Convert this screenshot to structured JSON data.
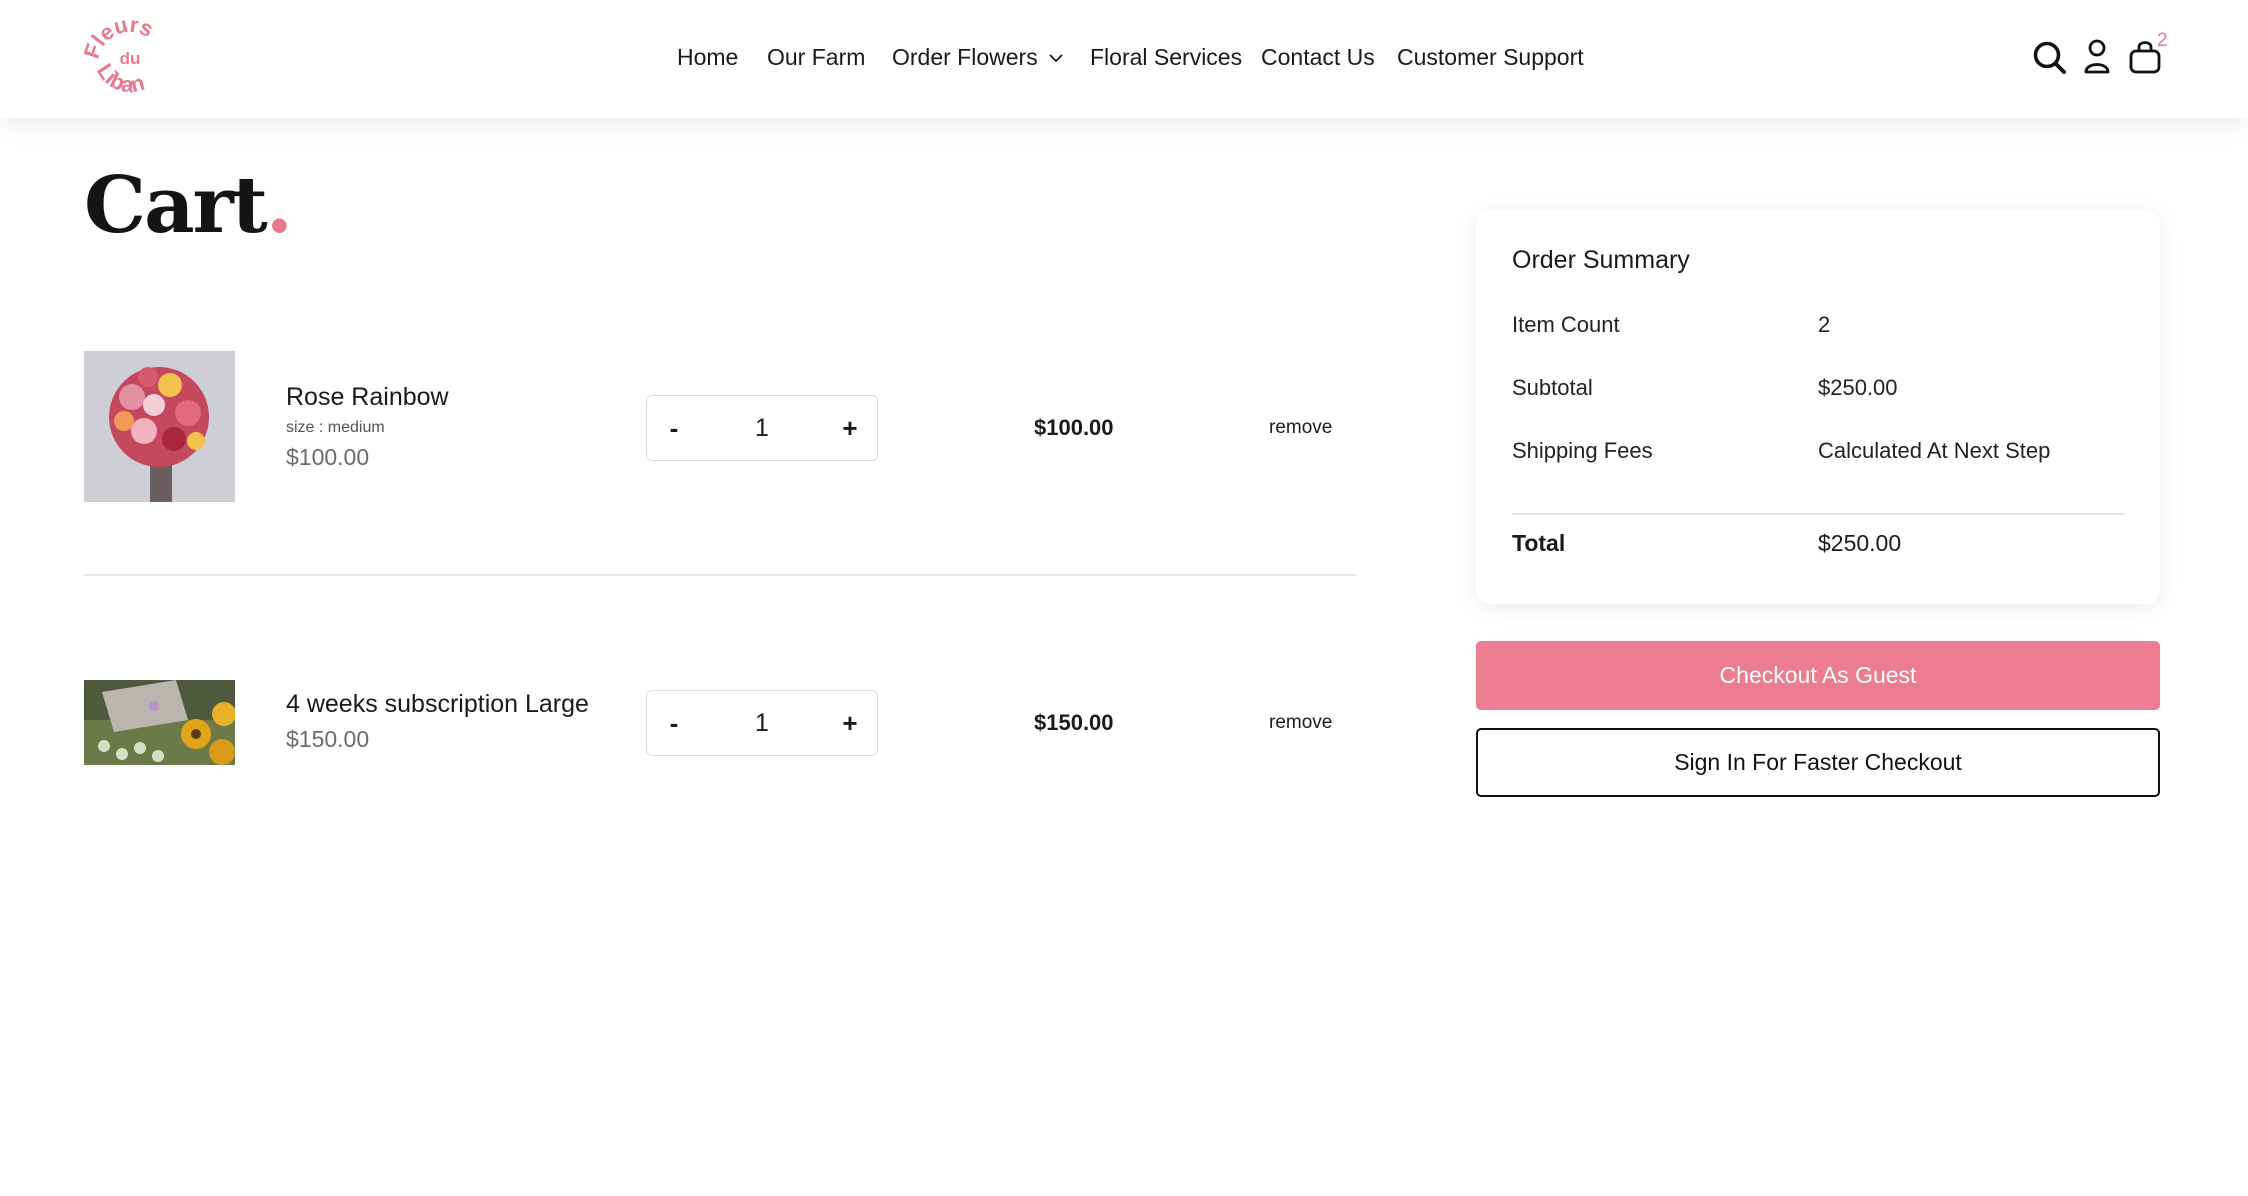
{
  "brand": {
    "logo_text_top": "Fleurs",
    "logo_text_mid": "du",
    "logo_text_bottom": "Liban",
    "accent": "#e8798d"
  },
  "nav": {
    "home": "Home",
    "farm": "Our Farm",
    "order": "Order Flowers",
    "services": "Floral Services",
    "contact": "Contact Us",
    "support": "Customer Support"
  },
  "header_icons": {
    "search": "search-icon",
    "account": "user-icon",
    "cart": "shopping-bag-icon",
    "cart_count": "2"
  },
  "page": {
    "title": "Cart",
    "title_dot": "."
  },
  "cart": {
    "items": [
      {
        "name": "Rose Rainbow",
        "size": "size : medium",
        "unit_price": "$100.00",
        "quantity": "1",
        "line_total": "$100.00",
        "remove": "remove",
        "minus": "-",
        "plus": "+"
      },
      {
        "name": "4 weeks subscription Large",
        "unit_price": "$150.00",
        "quantity": "1",
        "line_total": "$150.00",
        "remove": "remove",
        "minus": "-",
        "plus": "+"
      }
    ]
  },
  "summary": {
    "title": "Order Summary",
    "item_count_label": "Item Count",
    "item_count_value": "2",
    "subtotal_label": "Subtotal",
    "subtotal_value": "$250.00",
    "shipping_label": "Shipping Fees",
    "shipping_value": "Calculated At Next Step",
    "total_label": "Total",
    "total_value": "$250.00"
  },
  "actions": {
    "guest_checkout": "Checkout As Guest",
    "sign_in": "Sign In For Faster Checkout"
  }
}
